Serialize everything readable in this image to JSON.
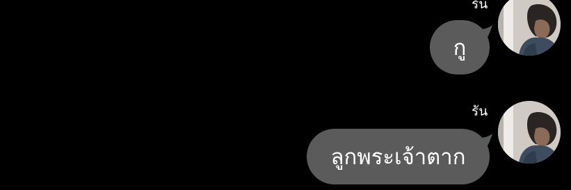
{
  "colors": {
    "background": "#000000",
    "bubble": "#5b5b5b",
    "text": "#ffffff"
  },
  "messages": [
    {
      "sender": "รัน",
      "text": "กู",
      "avatar_icon": "profile-photo"
    },
    {
      "sender": "รัน",
      "text": "ลูกพระเจ้าตาก",
      "avatar_icon": "profile-photo"
    }
  ]
}
